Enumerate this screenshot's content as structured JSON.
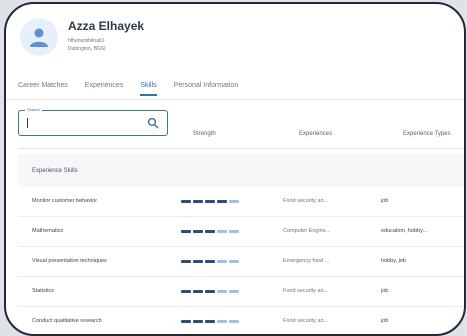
{
  "profile": {
    "name": "Azza Elhayek",
    "email": "hfhensmihilnab1",
    "location": "Dubington, BGSI"
  },
  "tabs": [
    {
      "label": "Career Matches",
      "active": false
    },
    {
      "label": "Experiences",
      "active": false
    },
    {
      "label": "Skills",
      "active": true
    },
    {
      "label": "Personal Information",
      "active": false
    }
  ],
  "search": {
    "label": "Search",
    "value": ""
  },
  "columns": {
    "strength": "Strength",
    "experiences": "Experiences",
    "types": "Experience Types"
  },
  "section_title": "Experience Skills",
  "skills": [
    {
      "name": "Monitor customer behavior",
      "strength": 4,
      "max": 5,
      "experience": "Food security an...",
      "type": "job"
    },
    {
      "name": "Mathematics",
      "strength": 3,
      "max": 5,
      "experience": "Computer Engine...",
      "type": "education, hobby..."
    },
    {
      "name": "Visual presentation techniques",
      "strength": 3,
      "max": 5,
      "experience": "Emergency food ...",
      "type": "hobby, job"
    },
    {
      "name": "Statistics",
      "strength": 3,
      "max": 5,
      "experience": "Food security an...",
      "type": "job"
    },
    {
      "name": "Conduct qualitative research",
      "strength": 3,
      "max": 5,
      "experience": "Food security an...",
      "type": "job"
    }
  ],
  "colors": {
    "accent": "#3f6f9a",
    "strength_filled": "#2a4d7b",
    "strength_empty": "#9fc1e3"
  }
}
